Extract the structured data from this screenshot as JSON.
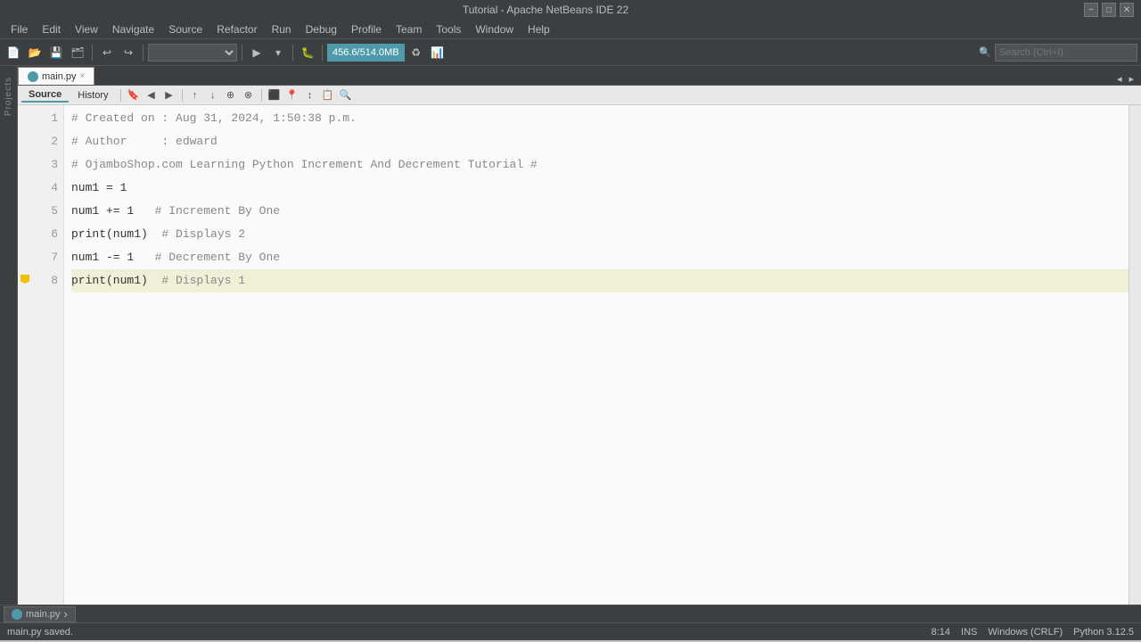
{
  "window": {
    "title": "Tutorial - Apache NetBeans IDE 22",
    "minimize_label": "−",
    "restore_label": "□",
    "close_label": "✕"
  },
  "menu": {
    "items": [
      "File",
      "Edit",
      "View",
      "Navigate",
      "Source",
      "Refactor",
      "Run",
      "Debug",
      "Profile",
      "Team",
      "Tools",
      "Window",
      "Help"
    ]
  },
  "toolbar": {
    "memory_btn": "456.6/514.0MB",
    "search_placeholder": "Search (Ctrl+I)"
  },
  "tabs": {
    "active_tab": "main.py",
    "close_symbol": "×"
  },
  "editor_tabs": {
    "source_label": "Source",
    "history_label": "History"
  },
  "code": {
    "lines": [
      {
        "num": "1",
        "content": "# Created on : Aug 31, 2024, 1:50:38 p.m.",
        "type": "comment",
        "highlight": false
      },
      {
        "num": "2",
        "content": "# Author     : edward",
        "type": "comment",
        "highlight": false
      },
      {
        "num": "3",
        "content": "# OjamboShop.com Learning Python Increment And Decrement Tutorial #",
        "type": "comment",
        "highlight": false
      },
      {
        "num": "4",
        "content": "num1 = 1",
        "type": "code",
        "highlight": false
      },
      {
        "num": "5",
        "content": "num1 += 1   # Increment By One",
        "type": "code",
        "highlight": false
      },
      {
        "num": "6",
        "content": "print(num1)  # Displays 2",
        "type": "code",
        "highlight": false
      },
      {
        "num": "7",
        "content": "num1 -= 1   # Decrement By One",
        "type": "code",
        "highlight": false
      },
      {
        "num": "8",
        "content": "print(num1)  # Displays 1",
        "type": "code",
        "highlight": true,
        "has_bookmark": true
      }
    ]
  },
  "status_bar": {
    "saved_text": "main.py saved.",
    "position": "8:14",
    "encoding": "INS",
    "line_ending": "Windows (CRLF)",
    "python_version": "Python 3.12.5"
  },
  "bottom_tab": {
    "label": "main.py",
    "arrow": "›"
  }
}
